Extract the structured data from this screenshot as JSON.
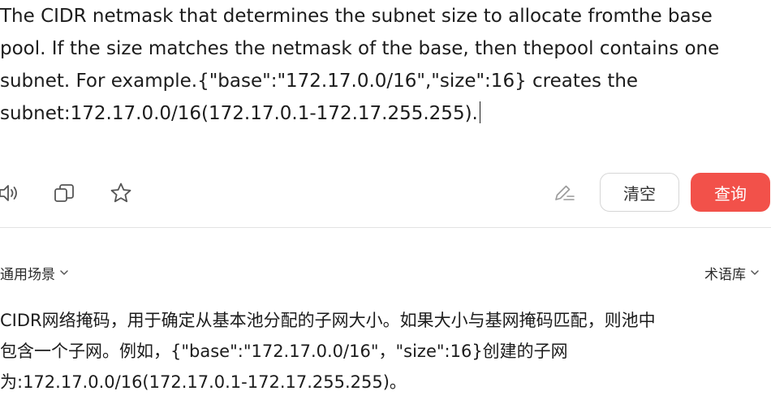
{
  "source": {
    "lines": [
      "The CIDR netmask that determines the subnet size to allocate fromthe base",
      "pool. If the size matches the netmask of the base, then thepool contains one",
      "subnet. For example.{\"base\":\"172.17.0.0/16\",\"size\":16} creates the",
      "subnet:172.17.0.0/16(172.17.0.1-172.17.255.255)."
    ]
  },
  "toolbar": {
    "icons": {
      "speaker": "speaker-icon",
      "copy": "copy-icon",
      "favorite": "star-icon",
      "edit": "pen-edit-icon"
    },
    "clear_label": "清空",
    "query_label": "查询",
    "query_color": "#f2514a"
  },
  "result": {
    "scene_label": "通用场景",
    "glossary_label": "术语库",
    "lines": [
      "CIDR网络掩码，用于确定从基本池分配的子网大小。如果大小与基网掩码匹配，则池中",
      "包含一个子网。例如，{\"base\":\"172.17.0.0/16\"，\"size\":16}创建的子网",
      "为:172.17.0.0/16(172.17.0.1-172.17.255.255)。"
    ]
  }
}
